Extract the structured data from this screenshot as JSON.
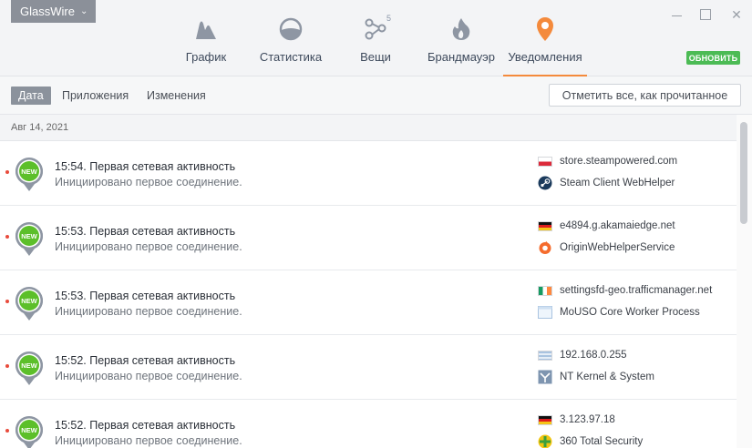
{
  "app": {
    "brand": "GlassWire"
  },
  "nav": {
    "items": [
      {
        "label": "График",
        "icon": "graph-icon"
      },
      {
        "label": "Статистика",
        "icon": "stats-icon"
      },
      {
        "label": "Вещи",
        "icon": "things-icon",
        "count": "5"
      },
      {
        "label": "Брандмауэр",
        "icon": "firewall-icon"
      },
      {
        "label": "Уведомления",
        "icon": "alerts-icon",
        "active": true
      }
    ],
    "update_label": "ОБНОВИТЬ"
  },
  "subnav": {
    "tabs": [
      {
        "label": "Дата",
        "active": true
      },
      {
        "label": "Приложения"
      },
      {
        "label": "Изменения"
      }
    ],
    "mark_all_label": "Отметить все, как прочитанное"
  },
  "list": {
    "date_header": "Авг 14, 2021",
    "badge_text": "NEW",
    "rows": [
      {
        "title": "15:54. Первая сетевая активность",
        "subtitle": "Инициировано первое соединение.",
        "host": "store.steampowered.com",
        "flag": "poland",
        "process": "Steam Client WebHelper",
        "process_icon": "steam-icon"
      },
      {
        "title": "15:53. Первая сетевая активность",
        "subtitle": "Инициировано первое соединение.",
        "host": "e4894.g.akamaiedge.net",
        "flag": "germany",
        "process": "OriginWebHelperService",
        "process_icon": "origin-icon"
      },
      {
        "title": "15:53. Первая сетевая активность",
        "subtitle": "Инициировано первое соединение.",
        "host": "settingsfd-geo.trafficmanager.net",
        "flag": "ireland",
        "process": "MoUSO Core Worker Process",
        "process_icon": "window-icon"
      },
      {
        "title": "15:52. Первая сетевая активность",
        "subtitle": "Инициировано первое соединение.",
        "host": "192.168.0.255",
        "flag": "local-network",
        "process": "NT Kernel & System",
        "process_icon": "system-icon"
      },
      {
        "title": "15:52. Первая сетевая активность",
        "subtitle": "Инициировано первое соединение.",
        "host": "3.123.97.18",
        "flag": "germany",
        "process": "360 Total Security",
        "process_icon": "360-security-icon"
      }
    ]
  },
  "colors": {
    "accent": "#f48a3c",
    "update_green": "#4cbb55",
    "new_badge_green": "#5cbf2a",
    "unread_dot": "#e84b3c"
  }
}
